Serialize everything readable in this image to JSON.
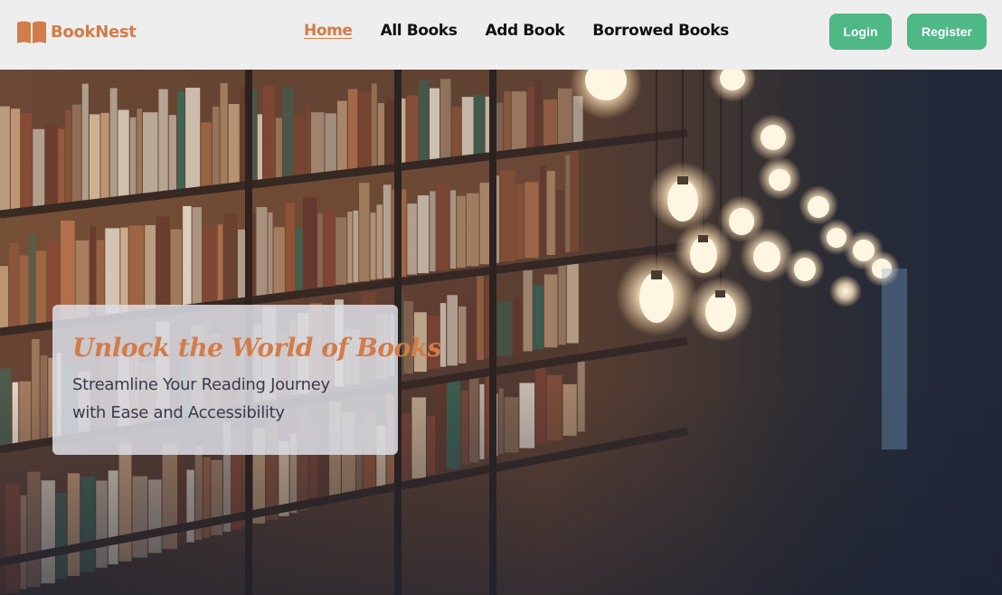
{
  "brand": {
    "name": "BookNest",
    "icon": "open-book-icon",
    "color": "#d27c4a"
  },
  "nav": {
    "links": [
      {
        "label": "Home",
        "active": true
      },
      {
        "label": "All Books",
        "active": false
      },
      {
        "label": "Add Book",
        "active": false
      },
      {
        "label": "Borrowed Books",
        "active": false
      }
    ]
  },
  "auth": {
    "login_label": "Login",
    "register_label": "Register",
    "button_color": "#4eb886"
  },
  "hero": {
    "title": "Unlock the World of Books",
    "subtitle": "Streamline Your Reading Journey with Ease and Accessibility",
    "background": "library-bookshelves-with-hanging-bulbs"
  }
}
